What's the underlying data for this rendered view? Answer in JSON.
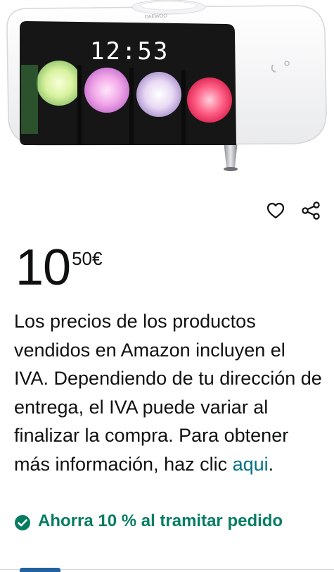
{
  "clock": {
    "time": "12:53"
  },
  "price": {
    "whole": "10",
    "fraction": "50",
    "currency": "€"
  },
  "vat_notice": {
    "text": "Los precios de los productos vendidos en Amazon incluyen el IVA. Dependiendo de tu dirección de entrega, el IVA puede variar al finalizar la compra. Para obtener más información, haz clic ",
    "link_label": "aqui",
    "suffix": "."
  },
  "coupon": {
    "text": "Ahorra 10 % al tramitar pedido",
    "color": "#067d62"
  },
  "icons": {
    "wishlist": "heart-icon",
    "share": "share-icon",
    "coupon": "check-circle-icon"
  },
  "colors": {
    "link": "#007185",
    "text": "#0f1111",
    "tab_indicator": "#2162a1"
  }
}
